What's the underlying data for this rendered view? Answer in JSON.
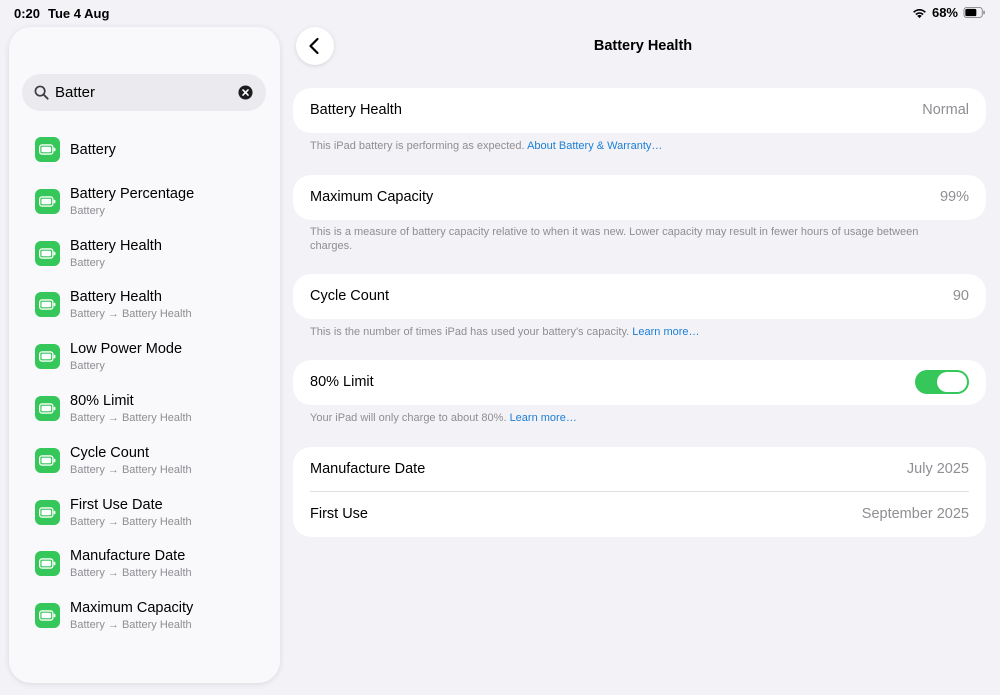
{
  "status_bar": {
    "time": "0:20",
    "date": "Tue 4 Aug",
    "battery_percent": "68%"
  },
  "sidebar": {
    "search": {
      "value": "Batter",
      "placeholder": "Search"
    },
    "results": [
      {
        "title": "Battery",
        "subtitle": ""
      },
      {
        "title": "Battery Percentage",
        "subtitle": "Battery"
      },
      {
        "title": "Battery Health",
        "subtitle": "Battery"
      },
      {
        "title": "Battery Health",
        "subtitle": "Battery → Battery Health"
      },
      {
        "title": "Low Power Mode",
        "subtitle": "Battery"
      },
      {
        "title": "80% Limit",
        "subtitle": "Battery → Battery Health"
      },
      {
        "title": "Cycle Count",
        "subtitle": "Battery → Battery Health"
      },
      {
        "title": "First Use Date",
        "subtitle": "Battery → Battery Health"
      },
      {
        "title": "Manufacture Date",
        "subtitle": "Battery → Battery Health"
      },
      {
        "title": "Maximum Capacity",
        "subtitle": "Battery → Battery Health"
      }
    ]
  },
  "main": {
    "title": "Battery Health",
    "battery_health": {
      "label": "Battery Health",
      "value": "Normal",
      "note": "This iPad battery is performing as expected.",
      "link": "About Battery & Warranty…"
    },
    "maximum_capacity": {
      "label": "Maximum Capacity",
      "value": "99%",
      "note": "This is a measure of battery capacity relative to when it was new. Lower capacity may result in fewer hours of usage between charges."
    },
    "cycle_count": {
      "label": "Cycle Count",
      "value": "90",
      "note": "This is the number of times iPad has used your battery's capacity.",
      "link": "Learn more…"
    },
    "limit_80": {
      "label": "80% Limit",
      "enabled": true,
      "note": "Your iPad will only charge to about 80%.",
      "link": "Learn more…"
    },
    "dates": {
      "manufacture_label": "Manufacture Date",
      "manufacture_value": "July 2025",
      "first_use_label": "First Use",
      "first_use_value": "September 2025"
    }
  },
  "colors": {
    "accent_green": "#35c759",
    "link_blue": "#1d7fd6",
    "secondary_text": "#8e8e93"
  }
}
